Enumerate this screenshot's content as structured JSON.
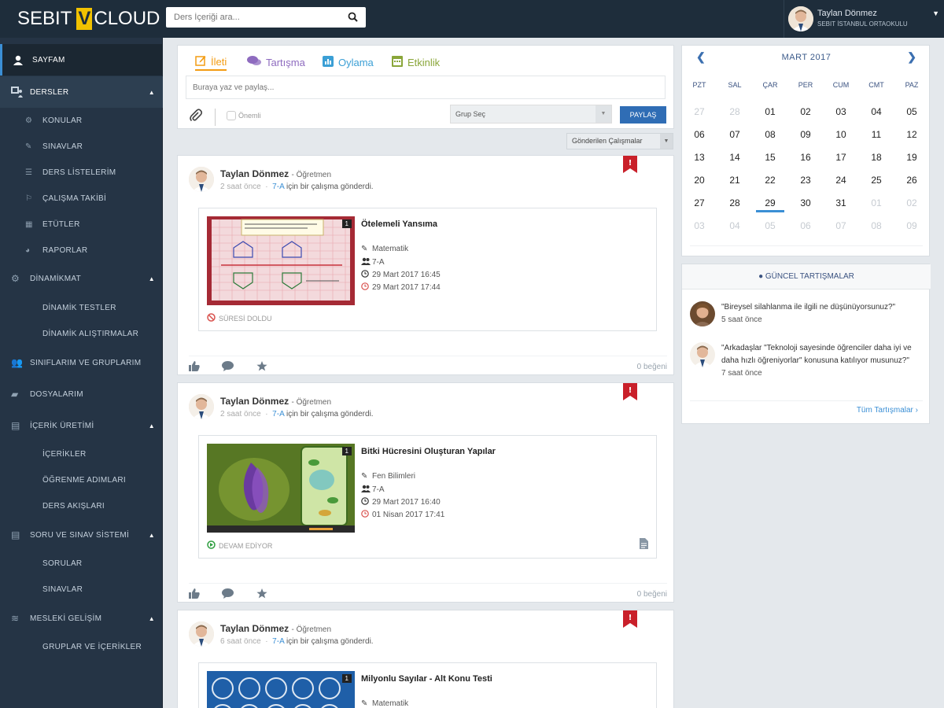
{
  "header": {
    "logo_left": "SEBIT",
    "logo_mark": "V",
    "logo_right": "CLOUD",
    "search_placeholder": "Ders İçeriği ara...",
    "user_name": "Taylan Dönmez",
    "user_school": "SEBIT İSTANBUL ORTAOKULU"
  },
  "sidebar": {
    "items": [
      {
        "label": "SAYFAM",
        "icon": "user-icon"
      },
      {
        "label": "DERSLER",
        "icon": "lessons-icon"
      },
      {
        "label": "KONULAR",
        "icon": "topics-icon"
      },
      {
        "label": "SINAVLAR",
        "icon": "pencil-icon"
      },
      {
        "label": "DERS LİSTELERİM",
        "icon": "list-icon"
      },
      {
        "label": "ÇALIŞMA TAKİBİ",
        "icon": "tracking-icon"
      },
      {
        "label": "ETÜTLER",
        "icon": "calendar-icon"
      },
      {
        "label": "RAPORLAR",
        "icon": "chart-icon"
      },
      {
        "label": "DİNAMİKMAT",
        "icon": "gear-icon"
      },
      {
        "label": "DİNAMİK TESTLER",
        "icon": ""
      },
      {
        "label": "DİNAMİK ALIŞTIRMALAR",
        "icon": ""
      },
      {
        "label": "SINIFLARIM VE GRUPLARIM",
        "icon": "group-icon"
      },
      {
        "label": "DOSYALARIM",
        "icon": "folder-icon"
      },
      {
        "label": "İÇERİK ÜRETİMİ",
        "icon": "content-icon"
      },
      {
        "label": "İÇERİKLER",
        "icon": ""
      },
      {
        "label": "ÖĞRENME ADIMLARI",
        "icon": ""
      },
      {
        "label": "DERS AKIŞLARI",
        "icon": ""
      },
      {
        "label": "SORU VE SINAV SİSTEMİ",
        "icon": "question-icon"
      },
      {
        "label": "SORULAR",
        "icon": ""
      },
      {
        "label": "SINAVLAR",
        "icon": ""
      },
      {
        "label": "MESLEKİ GELİŞİM",
        "icon": "development-icon"
      },
      {
        "label": "GRUPLAR VE İÇERİKLER",
        "icon": ""
      }
    ]
  },
  "composer": {
    "tabs": [
      {
        "label": "İleti",
        "icon": "edit-icon",
        "color": "#f39c12"
      },
      {
        "label": "Tartışma",
        "icon": "comments-icon",
        "color": "#8e6bbf"
      },
      {
        "label": "Oylama",
        "icon": "poll-icon",
        "color": "#3b9fd5"
      },
      {
        "label": "Etkinlik",
        "icon": "event-icon",
        "color": "#8aa63a"
      }
    ],
    "input_placeholder": "Buraya yaz ve paylaş...",
    "important_label": "Önemli",
    "group_select": "Grup Seç",
    "share_button": "PAYLAŞ"
  },
  "feed_filter": "Gönderilen Çalışmalar",
  "posts": [
    {
      "author": "Taylan Dönmez",
      "role": "- Öğretmen",
      "time": "2 saat önce",
      "class": "7-A",
      "action": "için bir çalışma gönderdi.",
      "title": "Ötelemeli Yansıma",
      "subject": "Matematik",
      "group": "7-A",
      "start": "29 Mart 2017 16:45",
      "end": "29 Mart 2017 17:44",
      "status": "SÜRESİ DOLDU",
      "status_color": "#d9534f",
      "badge": "1",
      "likes": "0 beğeni"
    },
    {
      "author": "Taylan Dönmez",
      "role": "- Öğretmen",
      "time": "2 saat önce",
      "class": "7-A",
      "action": "için bir çalışma gönderdi.",
      "title": "Bitki Hücresini Oluşturan Yapılar",
      "subject": "Fen Bilimleri",
      "group": "7-A",
      "start": "29 Mart 2017 16:40",
      "end": "01 Nisan 2017 17:41",
      "status": "DEVAM EDİYOR",
      "status_color": "#2e9e3f",
      "badge": "1",
      "likes": "0 beğeni"
    },
    {
      "author": "Taylan Dönmez",
      "role": "- Öğretmen",
      "time": "6 saat önce",
      "class": "7-A",
      "action": "için bir çalışma gönderdi.",
      "title": "Milyonlu Sayılar - Alt Konu Testi",
      "subject": "Matematik",
      "badge": "1"
    }
  ],
  "calendar": {
    "month": "MART 2017",
    "weekdays": [
      "PZT",
      "SAL",
      "ÇAR",
      "PER",
      "CUM",
      "CMT",
      "PAZ"
    ],
    "weeks": [
      [
        "27",
        "28",
        "01",
        "02",
        "03",
        "04",
        "05"
      ],
      [
        "06",
        "07",
        "08",
        "09",
        "10",
        "11",
        "12"
      ],
      [
        "13",
        "14",
        "15",
        "16",
        "17",
        "18",
        "19"
      ],
      [
        "20",
        "21",
        "22",
        "23",
        "24",
        "25",
        "26"
      ],
      [
        "27",
        "28",
        "29",
        "30",
        "31",
        "01",
        "02"
      ],
      [
        "03",
        "04",
        "05",
        "06",
        "07",
        "08",
        "09"
      ]
    ],
    "today": "29"
  },
  "discussions": {
    "title": "GÜNCEL TARTIŞMALAR",
    "items": [
      {
        "text": "\"Bireysel silahlanma ile ilgili ne düşünüyorsunuz?\"",
        "time": "5 saat önce"
      },
      {
        "text": "\"Arkadaşlar \"Teknoloji sayesinde öğrenciler daha iyi ve daha hızlı öğreniyorlar\" konusuna katılıyor musunuz?\"",
        "time": "7 saat önce"
      }
    ],
    "all_link": "Tüm Tartışmalar ›"
  }
}
